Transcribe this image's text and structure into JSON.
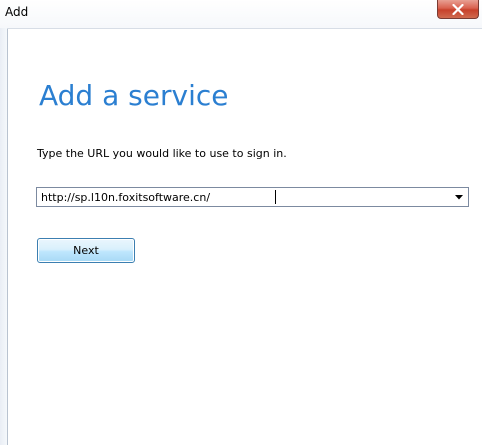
{
  "window": {
    "title": "Add",
    "close_icon": "close-x-icon"
  },
  "page": {
    "heading": "Add a service",
    "instruction": "Type the URL you would like to use to sign in."
  },
  "url_field": {
    "value": "http://sp.l10n.foxitsoftware.cn/",
    "dropdown_icon": "chevron-down-icon"
  },
  "buttons": {
    "next_label": "Next"
  },
  "colors": {
    "heading": "#2b7fd1",
    "close_button": "#c7412b",
    "button_border": "#3c7fb1"
  }
}
